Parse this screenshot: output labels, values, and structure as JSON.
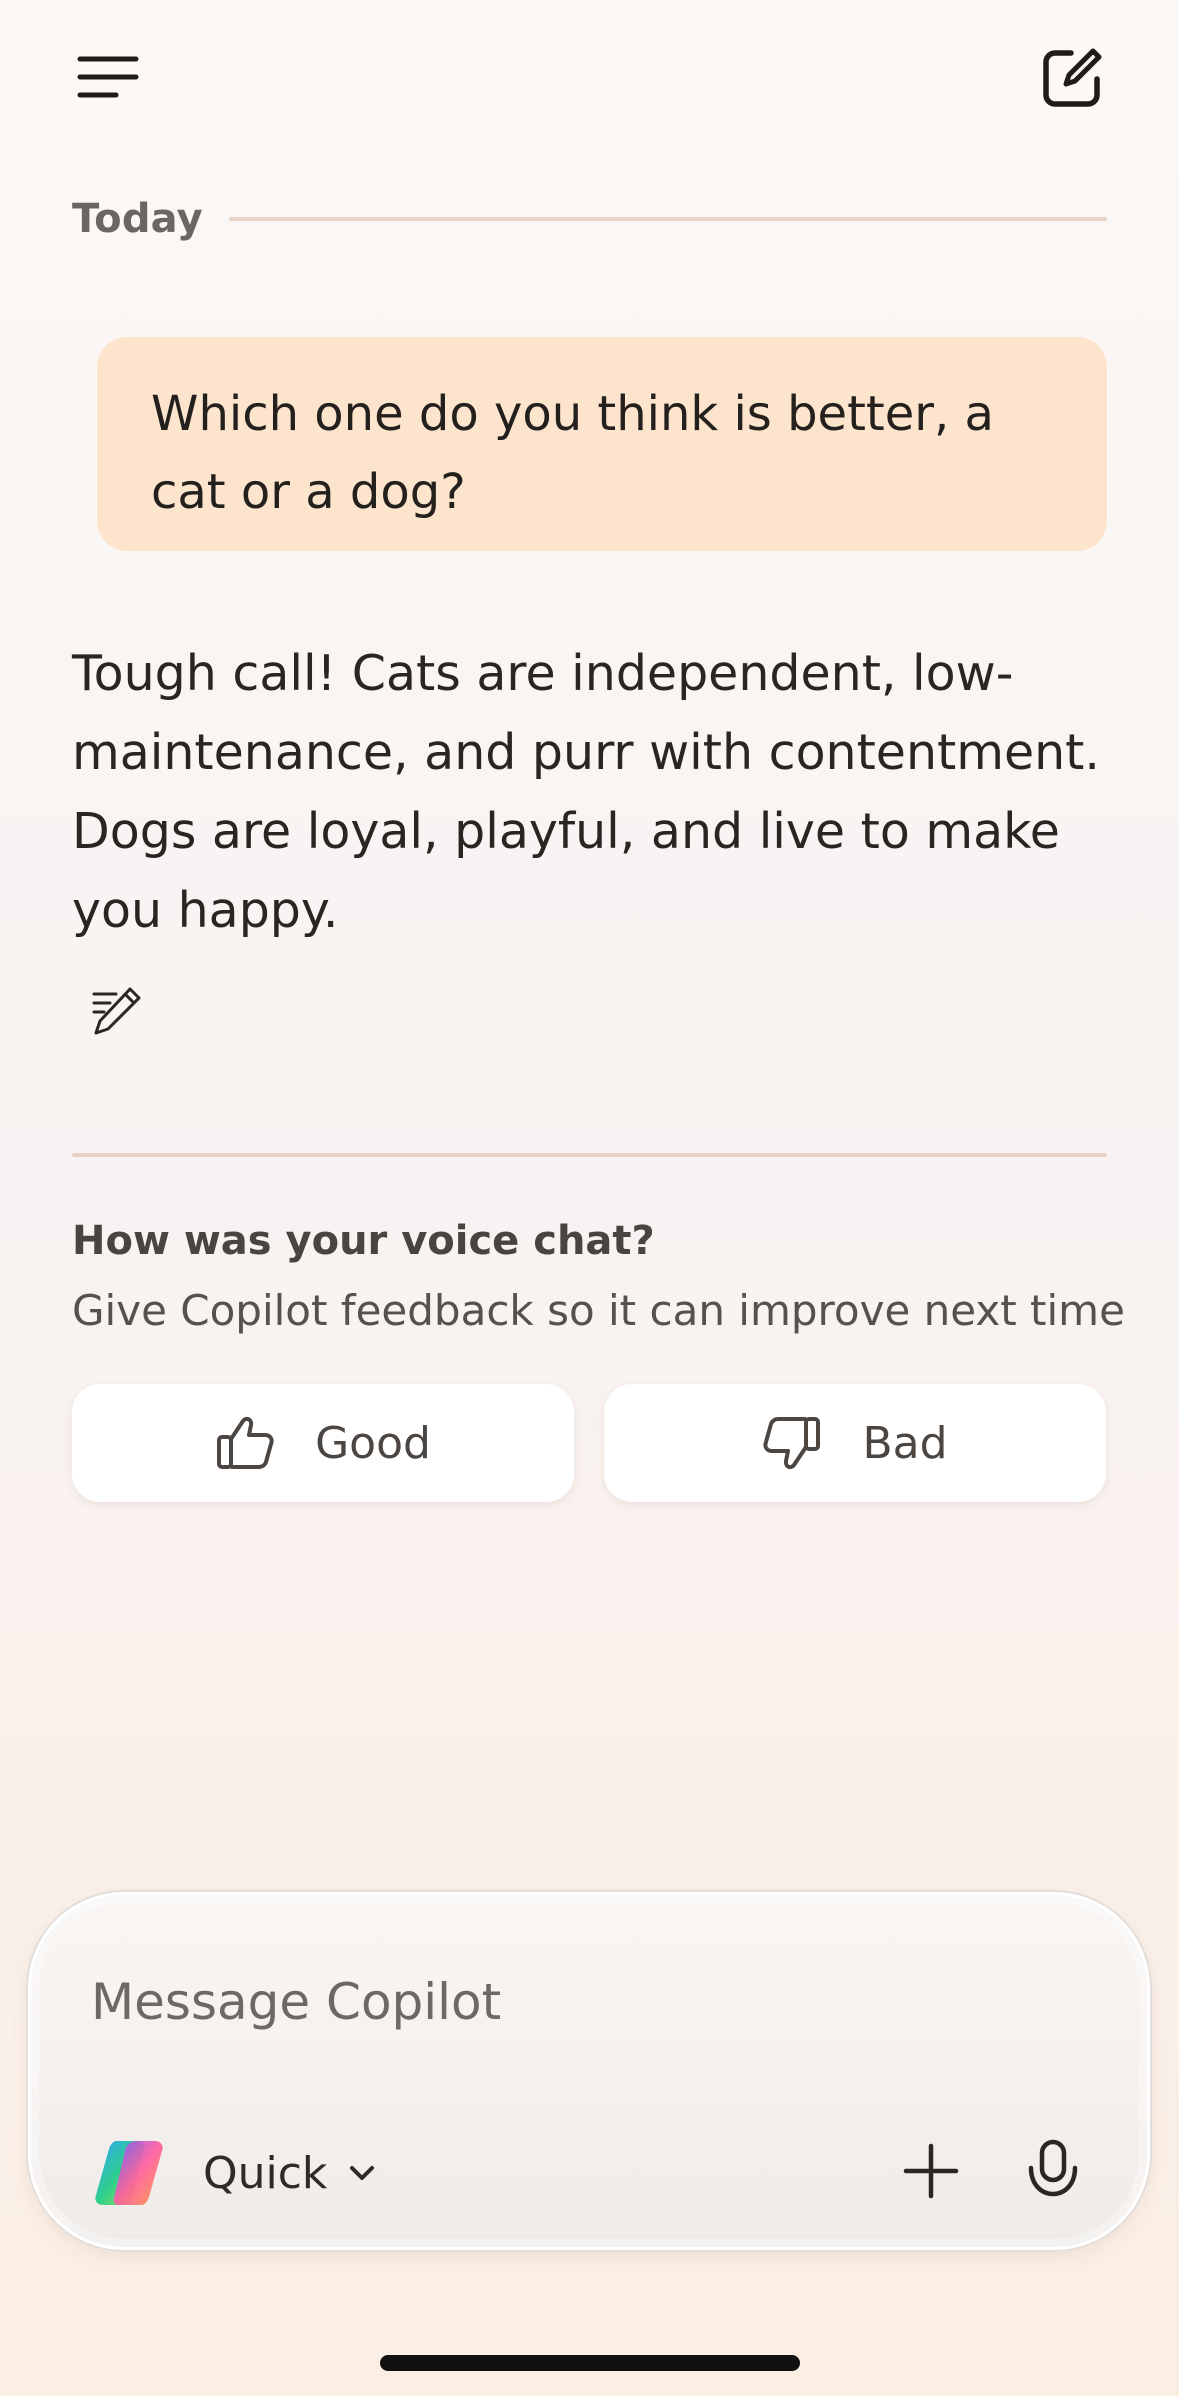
{
  "header": {
    "menu_icon": "hamburger-menu-icon",
    "compose_icon": "new-chat-icon"
  },
  "chat": {
    "date_label": "Today",
    "user_message": "Which one do you think is better, a cat or a dog?",
    "assistant_message": "Tough call! Cats are independent, low-maintenance, and purr with contentment. Dogs are loyal, playful, and live to make you happy.",
    "assistant_action_icon": "edit-pencil-icon"
  },
  "feedback": {
    "title": "How was your voice chat?",
    "subtitle": "Give Copilot feedback so it can improve next time",
    "good_label": "Good",
    "bad_label": "Bad"
  },
  "composer": {
    "placeholder": "Message Copilot",
    "mode_label": "Quick",
    "add_icon": "plus-icon",
    "mic_icon": "microphone-icon"
  },
  "colors": {
    "user_bubble": "#fde4cd",
    "divider": "#e6d2c6",
    "text_primary": "#2a2523"
  }
}
